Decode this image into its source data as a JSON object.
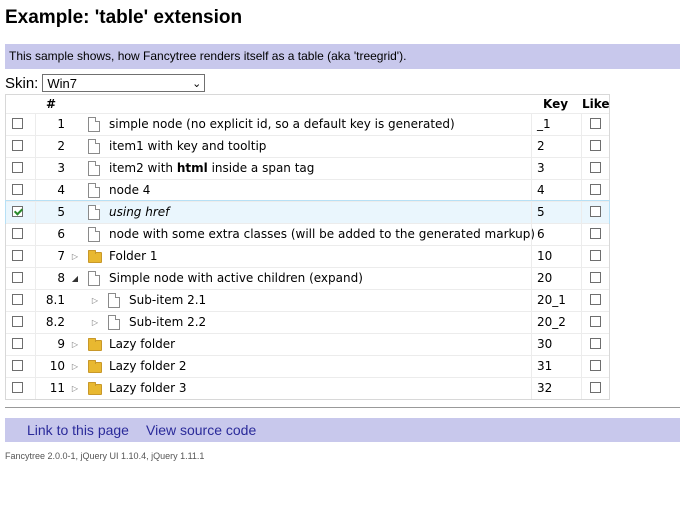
{
  "page": {
    "title": "Example: 'table' extension",
    "description": "This sample shows, how Fancytree renders itself as a table (aka 'treegrid')."
  },
  "skin": {
    "label": "Skin:",
    "selected": "Win7"
  },
  "table": {
    "headers": {
      "num": "#",
      "key": "Key",
      "like": "Like"
    },
    "rows": [
      {
        "num": "1",
        "title": "simple node (no explicit id, so a default key is generated)",
        "key": "_1",
        "checked": false,
        "icon": "document-icon",
        "level": 1,
        "expander": ""
      },
      {
        "num": "2",
        "title": "item1 with key and tooltip",
        "key": "2",
        "checked": false,
        "icon": "document-icon",
        "level": 1,
        "expander": ""
      },
      {
        "num": "3",
        "title_pre": "item2 with ",
        "title_bold": "html",
        "title_post": " inside a span tag",
        "key": "3",
        "checked": false,
        "icon": "document-icon",
        "level": 1,
        "expander": ""
      },
      {
        "num": "4",
        "title": "node 4",
        "key": "4",
        "checked": false,
        "icon": "document-icon",
        "level": 1,
        "expander": ""
      },
      {
        "num": "5",
        "title": "using href",
        "key": "5",
        "checked": true,
        "icon": "document-icon",
        "level": 1,
        "expander": "",
        "italic": true,
        "active": true
      },
      {
        "num": "6",
        "title": "node with some extra classes (will be added to the generated markup)",
        "key": "6",
        "checked": false,
        "icon": "document-icon",
        "level": 1,
        "expander": ""
      },
      {
        "num": "7",
        "title": "Folder 1",
        "key": "10",
        "checked": false,
        "icon": "folder-icon",
        "level": 1,
        "expander": "collapsed"
      },
      {
        "num": "8",
        "title": "Simple node with active children (expand)",
        "key": "20",
        "checked": false,
        "icon": "document-icon",
        "level": 1,
        "expander": "expanded"
      },
      {
        "num": "8.1",
        "title": "Sub-item 2.1",
        "key": "20_1",
        "checked": false,
        "icon": "document-icon",
        "level": 2,
        "expander": "collapsed"
      },
      {
        "num": "8.2",
        "title": "Sub-item 2.2",
        "key": "20_2",
        "checked": false,
        "icon": "document-icon",
        "level": 2,
        "expander": "collapsed"
      },
      {
        "num": "9",
        "title": "Lazy folder",
        "key": "30",
        "checked": false,
        "icon": "folder-icon",
        "level": 1,
        "expander": "collapsed"
      },
      {
        "num": "10",
        "title": "Lazy folder 2",
        "key": "31",
        "checked": false,
        "icon": "folder-icon",
        "level": 1,
        "expander": "collapsed"
      },
      {
        "num": "11",
        "title": "Lazy folder 3",
        "key": "32",
        "checked": false,
        "icon": "folder-icon",
        "level": 1,
        "expander": "collapsed"
      }
    ]
  },
  "links": {
    "link_page": "Link to this page",
    "view_source": "View source code"
  },
  "footer": "Fancytree 2.0.0-1, jQuery UI 1.10.4, jQuery 1.11.1",
  "colors": {
    "bar": "#c8c8ec",
    "active_row": "#eaf6fd",
    "link": "#2a2a9a"
  }
}
